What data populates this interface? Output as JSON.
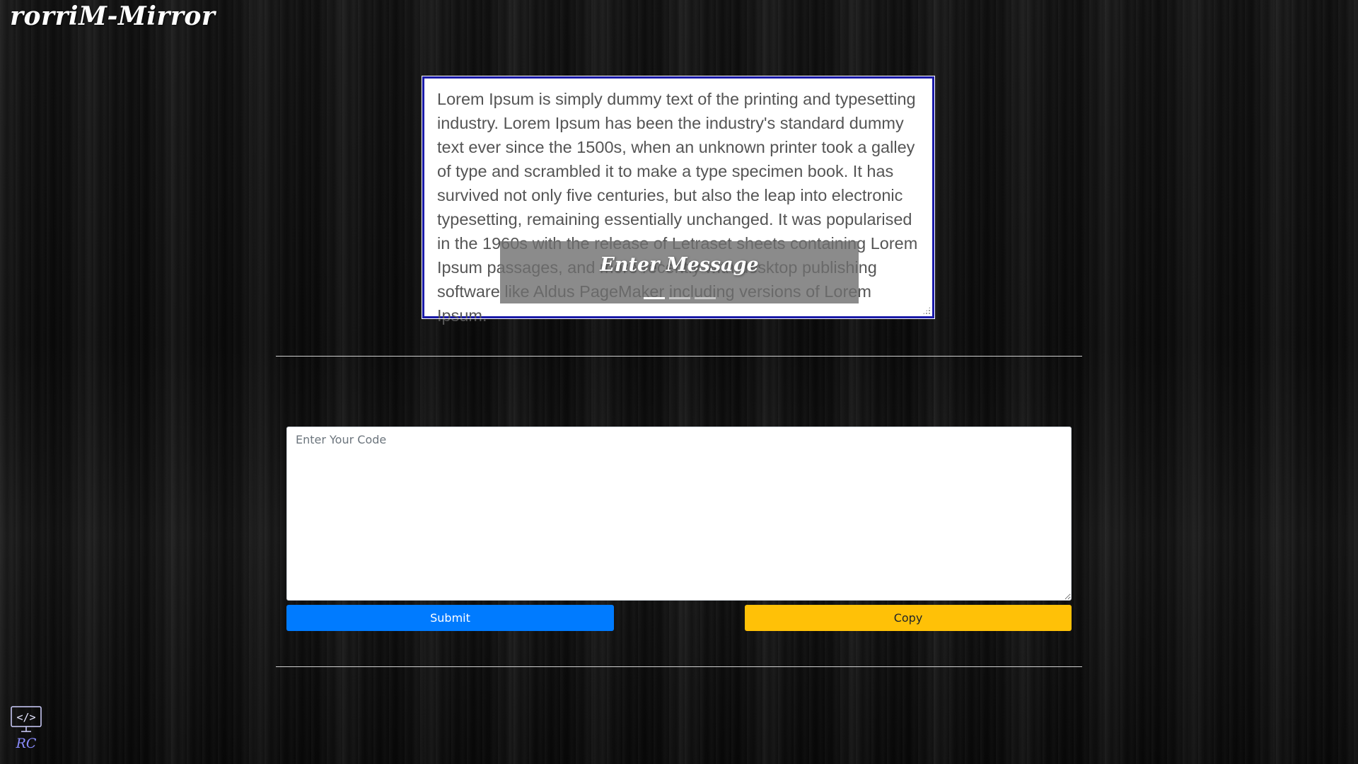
{
  "header": {
    "title": "rorriM-Mirror"
  },
  "message": {
    "text": "Lorem Ipsum is simply dummy text of the printing and typesetting industry. Lorem Ipsum has been the industry's standard dummy text ever since the 1500s, when an unknown printer took a galley of type and scrambled it to make a type specimen book. It has survived not only five centuries, but also the leap into electronic typesetting, remaining essentially unchanged. It was popularised in the 1960s with the release of Letraset sheets containing Lorem Ipsum passages, and more recently with desktop publishing software like Aldus PageMaker including versions of Lorem Ipsum."
  },
  "carousel": {
    "caption": "Enter Message",
    "slide_count": 3,
    "active_index": 0
  },
  "code": {
    "placeholder": "Enter Your Code",
    "value": ""
  },
  "actions": {
    "submit_label": "Submit",
    "copy_label": "Copy"
  },
  "footer": {
    "logo_icon": "code-monitor-icon",
    "logo_text": "RC"
  },
  "colors": {
    "message_border": "#1a1aa8",
    "submit_bg": "#007bff",
    "copy_bg": "#ffc107",
    "logo_accent": "#8a8cff"
  }
}
